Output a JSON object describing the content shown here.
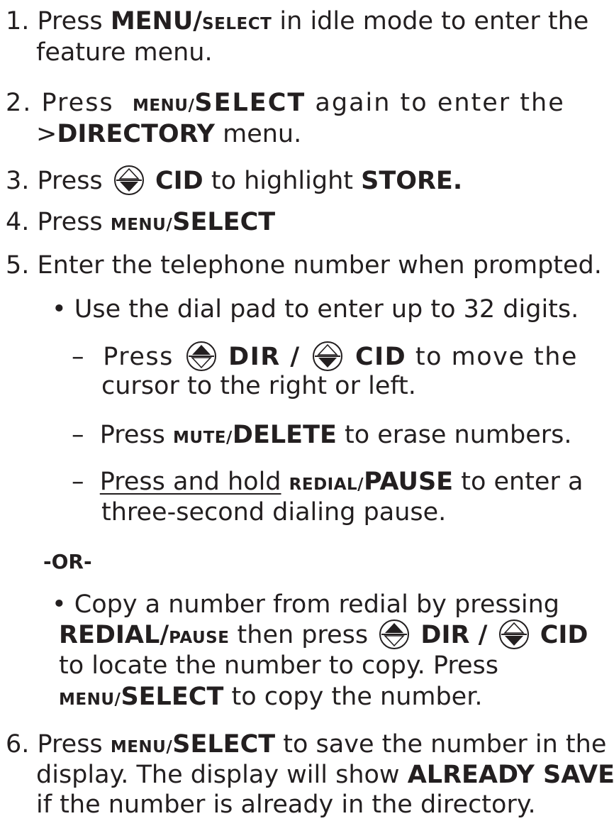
{
  "steps": {
    "s1": {
      "num": "1.",
      "pre": "Press",
      "key_big": "MENU/",
      "key_small": "SELECT",
      "post": "in idle mode to enter the",
      "cont": "feature menu."
    },
    "s2": {
      "num": "2.",
      "pre": "Press",
      "key_small": "MENU/",
      "key_big": "SELECT",
      "post": "again to enter the",
      "cont_pre": ">",
      "cont_key": "DIRECTORY",
      "cont_post": "menu."
    },
    "s3": {
      "num": "3.",
      "pre": "Press",
      "key": "CID",
      "mid": "to highlight",
      "target": "STORE."
    },
    "s4": {
      "num": "4.",
      "pre": "Press",
      "key_small": "MENU/",
      "key_big": "SELECT"
    },
    "s5": {
      "num": "5.",
      "text": "Enter the telephone number when prompted.",
      "bullet1": "• Use the dial pad to enter up to 32 digits.",
      "dash1": {
        "dash": "–",
        "pre": "Press",
        "key1": "DIR /",
        "key2": "CID",
        "post": "to move the",
        "cont": "cursor to the right or left."
      },
      "dash2": {
        "dash": "–",
        "pre": "Press",
        "key_small": "MUTE/",
        "key_big": "DELETE",
        "post": "to erase numbers."
      },
      "dash3": {
        "dash": "–",
        "underlined": "Press and hold",
        "key_small": "REDIAL/",
        "key_big": "PAUSE",
        "post": "to enter a",
        "cont": "three-second dialing pause."
      },
      "or": "-OR-",
      "bullet2": {
        "line1": "• Copy a number from redial by pressing",
        "key_big": "REDIAL/",
        "key_small": "PAUSE",
        "mid": "then press",
        "key1": "DIR /",
        "key2": "CID",
        "line3": "to locate the number to copy. Press",
        "l4_key_small": "MENU/",
        "l4_key_big": "SELECT",
        "l4_post": "to copy the number."
      }
    },
    "s6": {
      "num": "6.",
      "pre": "Press",
      "key_small": "MENU/",
      "key_big": "SELECT",
      "post": "to save the number in the",
      "line2_pre": "display. The display will show",
      "line2_key": "ALREADY SAVED",
      "line3": "if the number is already in the directory."
    }
  },
  "icons": {
    "up": "up-arrow-filled-icon",
    "down": "down-arrow-filled-icon"
  }
}
